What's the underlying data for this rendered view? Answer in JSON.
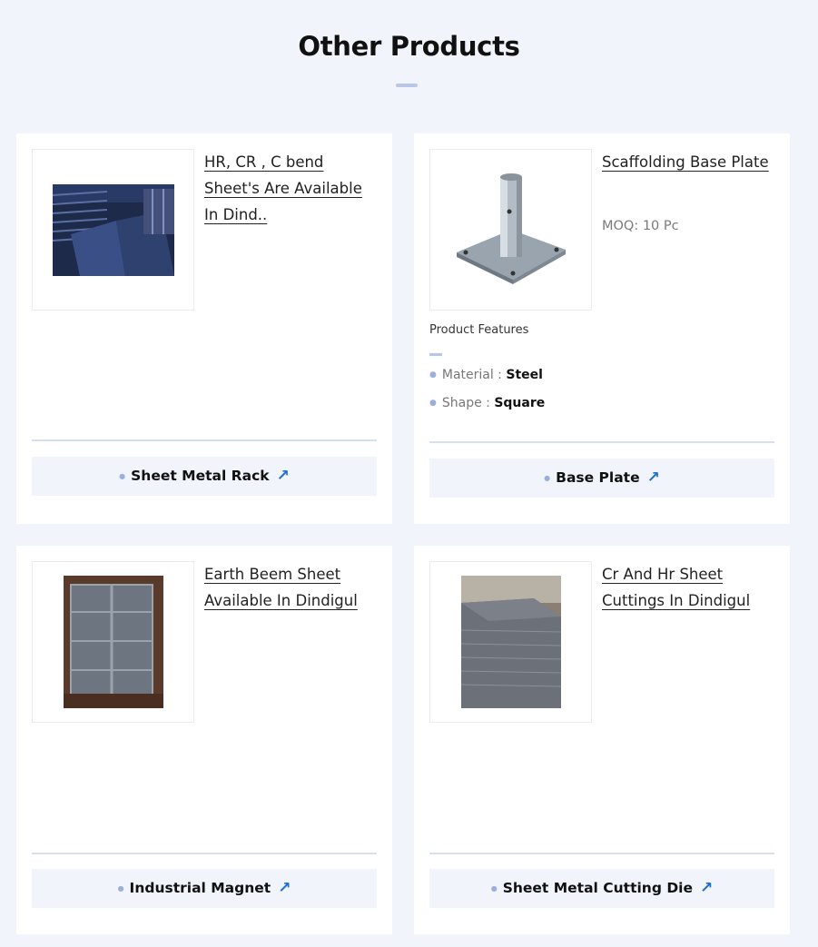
{
  "section": {
    "title": "Other Products"
  },
  "products": [
    {
      "title": "HR, CR , C bend Sheet's Are Available In Dind..",
      "category": "Sheet Metal Rack",
      "arrow": "↗"
    },
    {
      "title": "Scaffolding Base Plate",
      "moq": "MOQ: 10 Pc",
      "features_heading": "Product Features",
      "features": [
        {
          "label": "Material :",
          "value": "Steel"
        },
        {
          "label": "Shape :",
          "value": "Square"
        }
      ],
      "category": "Base Plate",
      "arrow": "↗"
    },
    {
      "title": "Earth Beem Sheet Available In Dindigul",
      "category": "Industrial Magnet",
      "arrow": "↗"
    },
    {
      "title": "Cr And Hr Sheet Cuttings In Dindigul",
      "category": "Sheet Metal Cutting Die",
      "arrow": "↗"
    }
  ],
  "colors": {
    "background": "#f1f4fb",
    "accent": "#1f6fd1",
    "title_bar": "#b9c6e6"
  }
}
